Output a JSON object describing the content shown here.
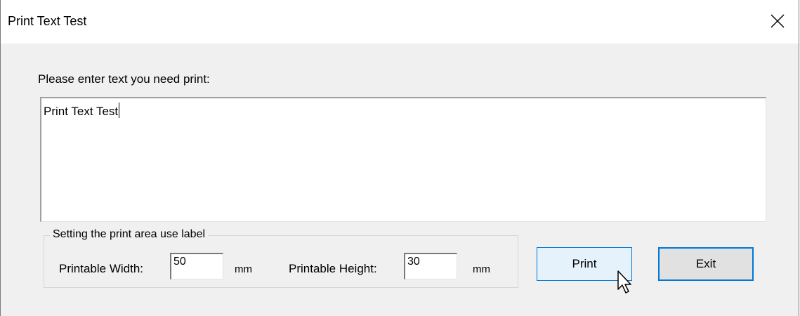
{
  "window": {
    "title": "Print Text Test",
    "close_icon": "close-icon"
  },
  "form": {
    "prompt": "Please enter text you need print:",
    "text_value": "Print Text Test"
  },
  "print_area": {
    "legend": "Setting the print area use label",
    "width_label": "Printable Width:",
    "width_value": "50",
    "width_unit": "mm",
    "height_label": "Printable Height:",
    "height_value": "30",
    "height_unit": "mm"
  },
  "buttons": {
    "print_label": "Print",
    "exit_label": "Exit"
  },
  "colors": {
    "accent": "#0078d7",
    "hover_bg": "#e5f1fb"
  }
}
